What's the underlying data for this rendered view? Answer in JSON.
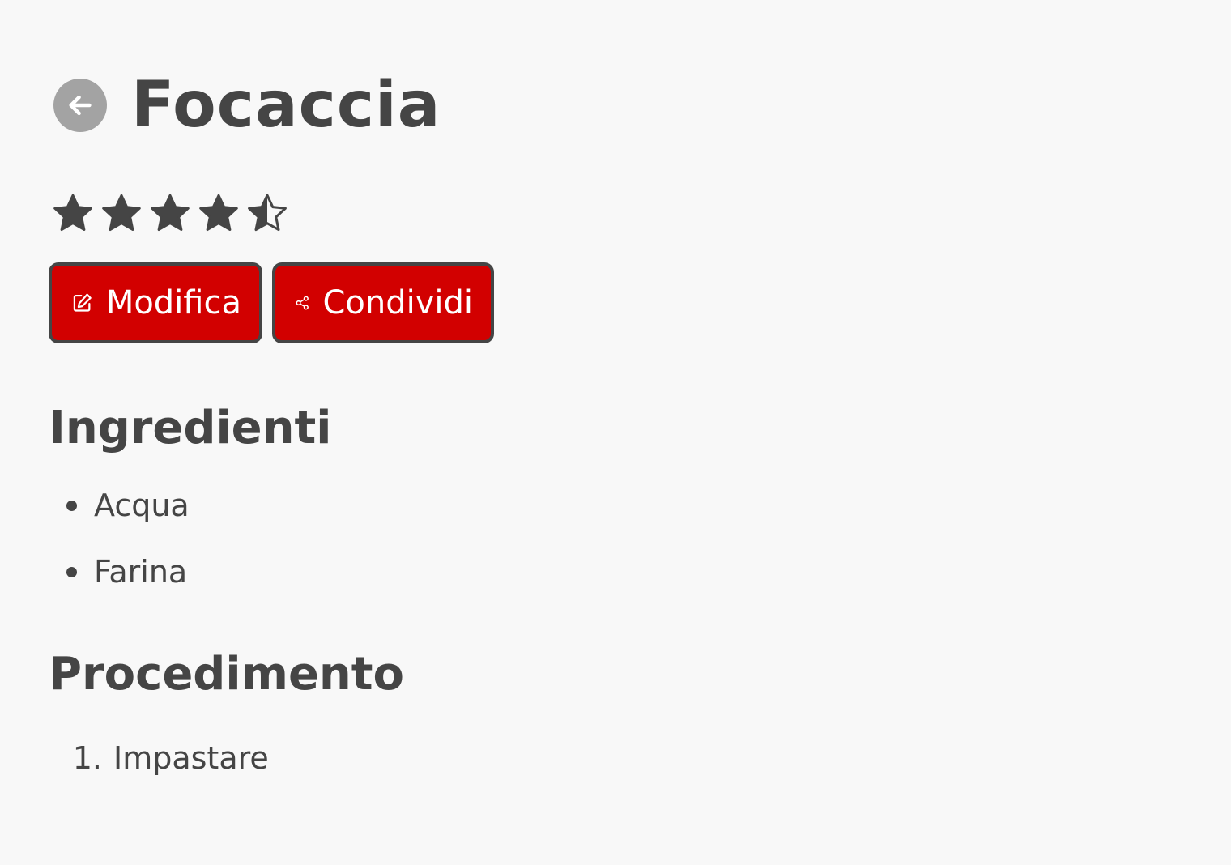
{
  "recipe": {
    "title": "Focaccia",
    "rating": 4.5,
    "rating_max": 5
  },
  "actions": {
    "edit_label": "Modifica",
    "share_label": "Condividi"
  },
  "ingredients": {
    "heading": "Ingredienti",
    "items": [
      "Acqua",
      "Farina"
    ]
  },
  "steps": {
    "heading": "Procedimento",
    "items": [
      {
        "number": "1.",
        "text": "Impastare"
      }
    ]
  },
  "colors": {
    "accent": "#d20000",
    "text": "#454545",
    "background": "#f8f8f8",
    "back_button": "#a3a3a3"
  },
  "icons": {
    "back": "arrow-left-circle-icon",
    "star_full": "star-filled-icon",
    "star_half": "star-half-icon",
    "edit": "pencil-square-icon",
    "share": "share-nodes-icon"
  }
}
